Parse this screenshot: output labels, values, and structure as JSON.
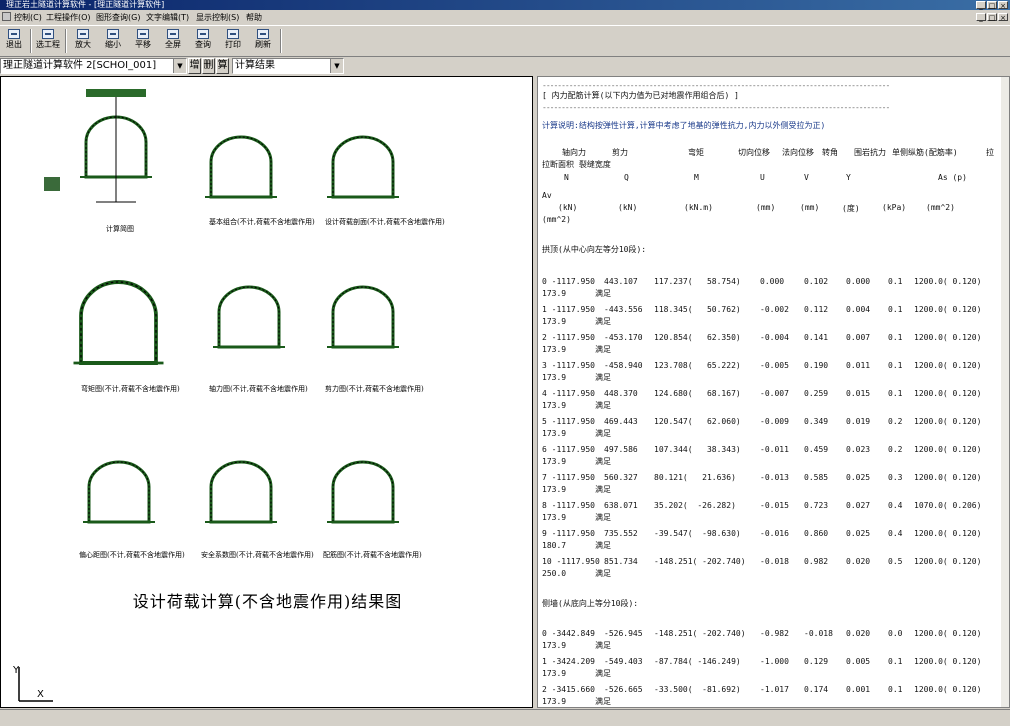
{
  "app": {
    "title": "理正岩土隧道计算软件 - [理正隧道计算软件]",
    "window_controls": [
      "_",
      "□",
      "×"
    ],
    "mdi_controls": [
      "_",
      "□",
      "×"
    ]
  },
  "menu": [
    "控制(C)",
    "工程操作(O)",
    "图形查询(G)",
    "文字编辑(T)",
    "显示控制(S)",
    "帮助"
  ],
  "toolbar": [
    "退出",
    "选工程",
    "放大",
    "缩小",
    "平移",
    "全屏",
    "查询",
    "打印",
    "刷新"
  ],
  "selector": {
    "project_combo": "理正隧道计算软件 2[SCHOI_001]",
    "btn1": "增",
    "btn2": "删",
    "btn3": "算",
    "result_combo": "计算结果"
  },
  "drawing": {
    "labels": [
      "计算简图",
      "基本组合(不计,荷载不含地震作用)",
      "设计荷载剖面(不计,荷载不含地震作用)",
      "弯矩图(不计,荷载不含地震作用)",
      "轴力图(不计,荷载不含地震作用)",
      "剪力图(不计,荷载不含地震作用)",
      "偏心距图(不计,荷载不含地震作用)",
      "安全系数图(不计,荷载不含地震作用)",
      "配筋图(不计,荷载不含地震作用)"
    ],
    "main_title": "设计荷载计算(不含地震作用)结果图",
    "axis_y": "Y",
    "axis_x": "X"
  },
  "results": {
    "heading": "[ 内力配筋计算(以下内力值为已对地震作用组合后) ]",
    "note": "计算说明:结构按弹性计算,计算中考虑了地基的弹性抗力,内力以外侧受拉为正)",
    "col_headers": [
      "轴向力",
      "剪力",
      "弯矩",
      "切向位移",
      "法向位移",
      "转角",
      "围岩抗力",
      "单侧纵筋(配筋率)",
      "拉"
    ],
    "col_headers2": "拉断面积 裂缝宽度",
    "units_sym": [
      "N",
      "Q",
      "M",
      "U",
      "V",
      "Y",
      "As (p)"
    ],
    "units": [
      "(kN)",
      "(kN)",
      "(kN.m)",
      "(mm)",
      "(mm)",
      "(度)",
      "(kPa)",
      "(mm^2)"
    ],
    "units_tail": "(mm^2)",
    "section1": "拱顶(从中心向左等分10段):",
    "rows1": [
      {
        "n": "0 -1117.950",
        "q": "443.107",
        "m": "117.237(   58.754)",
        "u": "0.000",
        "v": "0.102",
        "y": "0.000",
        "k": "0.1",
        "as": "1200.0( 0.120)",
        "tail": "173.9      满足"
      },
      {
        "n": "1 -1117.950",
        "q": "-443.556",
        "m": "118.345(   50.762)",
        "u": "-0.002",
        "v": "0.112",
        "y": "0.004",
        "k": "0.1",
        "as": "1200.0( 0.120)",
        "tail": "173.9      满足"
      },
      {
        "n": "2 -1117.950",
        "q": "-453.170",
        "m": "120.854(   62.350)",
        "u": "-0.004",
        "v": "0.141",
        "y": "0.007",
        "k": "0.1",
        "as": "1200.0( 0.120)",
        "tail": "173.9      满足"
      },
      {
        "n": "3 -1117.950",
        "q": "-458.940",
        "m": "123.708(   65.222)",
        "u": "-0.005",
        "v": "0.190",
        "y": "0.011",
        "k": "0.1",
        "as": "1200.0( 0.120)",
        "tail": "173.9      满足"
      },
      {
        "n": "4 -1117.950",
        "q": "448.370",
        "m": "124.680(   68.167)",
        "u": "-0.007",
        "v": "0.259",
        "y": "0.015",
        "k": "0.1",
        "as": "1200.0( 0.120)",
        "tail": "173.9      满足"
      },
      {
        "n": "5 -1117.950",
        "q": "469.443",
        "m": "120.547(   62.060)",
        "u": "-0.009",
        "v": "0.349",
        "y": "0.019",
        "k": "0.2",
        "as": "1200.0( 0.120)",
        "tail": "173.9      满足"
      },
      {
        "n": "6 -1117.950",
        "q": "497.586",
        "m": "107.344(   38.343)",
        "u": "-0.011",
        "v": "0.459",
        "y": "0.023",
        "k": "0.2",
        "as": "1200.0( 0.120)",
        "tail": "173.9      满足"
      },
      {
        "n": "7 -1117.950",
        "q": "560.327",
        "m": "80.121(   21.636)",
        "u": "-0.013",
        "v": "0.585",
        "y": "0.025",
        "k": "0.3",
        "as": "1200.0( 0.120)",
        "tail": "173.9      满足"
      },
      {
        "n": "8 -1117.950",
        "q": "638.071",
        "m": "35.202(  -26.282)",
        "u": "-0.015",
        "v": "0.723",
        "y": "0.027",
        "k": "0.4",
        "as": "1070.0( 0.206)",
        "tail": "173.9      满足"
      },
      {
        "n": "9 -1117.950",
        "q": "735.552",
        "m": "-39.547(  -98.630)",
        "u": "-0.016",
        "v": "0.860",
        "y": "0.025",
        "k": "0.4",
        "as": "1200.0( 0.120)",
        "tail": "180.7      满足"
      },
      {
        "n": "10 -1117.950",
        "q": "851.734",
        "m": "-148.251( -202.740)",
        "u": "-0.018",
        "v": "0.982",
        "y": "0.020",
        "k": "0.5",
        "as": "1200.0( 0.120)",
        "tail": "250.0      满足"
      }
    ],
    "section2": "侧墙(从底向上等分10段):",
    "rows2": [
      {
        "n": "0 -3442.849",
        "q": "-526.945",
        "m": "-148.251( -202.740)",
        "u": "-0.982",
        "v": "-0.018",
        "y": "0.020",
        "k": "0.0",
        "as": "1200.0( 0.120)",
        "tail": "173.9      满足"
      },
      {
        "n": "1 -3424.209",
        "q": "-549.403",
        "m": "-87.784( -146.249)",
        "u": "-1.000",
        "v": "0.129",
        "y": "0.005",
        "k": "0.1",
        "as": "1200.0( 0.120)",
        "tail": "173.9      满足"
      },
      {
        "n": "2 -3415.660",
        "q": "-526.665",
        "m": "-33.500(  -81.692)",
        "u": "-1.017",
        "v": "0.174",
        "y": "0.001",
        "k": "0.1",
        "as": "1200.0( 0.120)",
        "tail": "173.9      满足"
      }
    ]
  }
}
